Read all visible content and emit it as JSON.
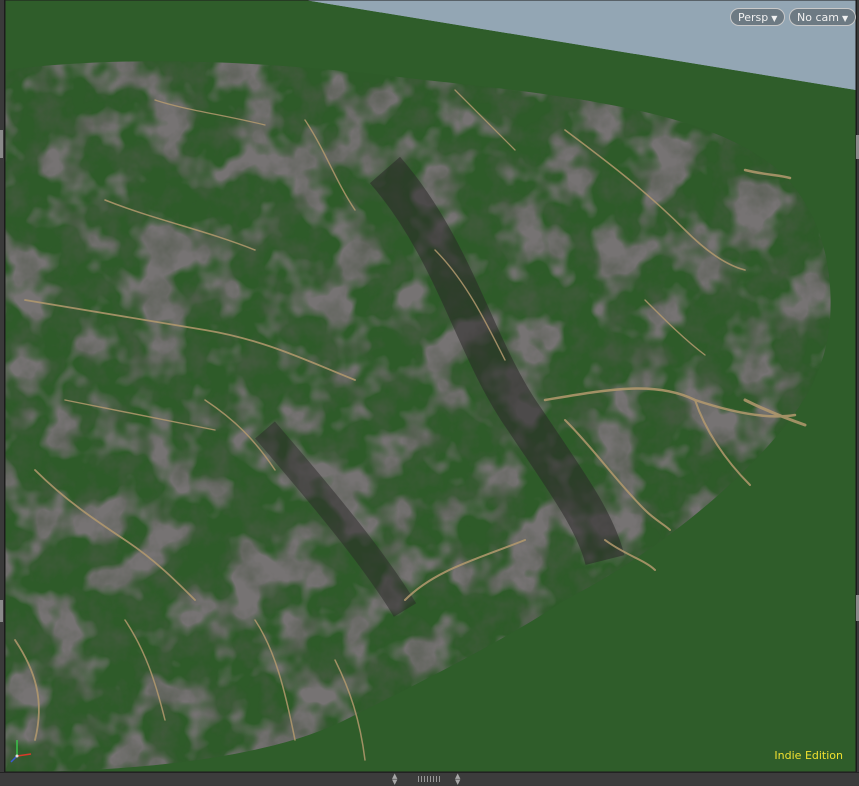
{
  "viewport": {
    "view_menu_label": "Persp",
    "camera_menu_label": "No cam",
    "edition_label": "Indie Edition",
    "icons": [
      "caret-down-icon",
      "axis-gizmo-icon",
      "resize-grip-icon",
      "up-arrow-icon",
      "down-arrow-icon"
    ]
  },
  "colors": {
    "sky": "#93a6b4",
    "grass": "#2f5d2a",
    "rock": "#2d2b2b",
    "sediment": "#b49a6e",
    "edition_text": "#f0e030"
  }
}
